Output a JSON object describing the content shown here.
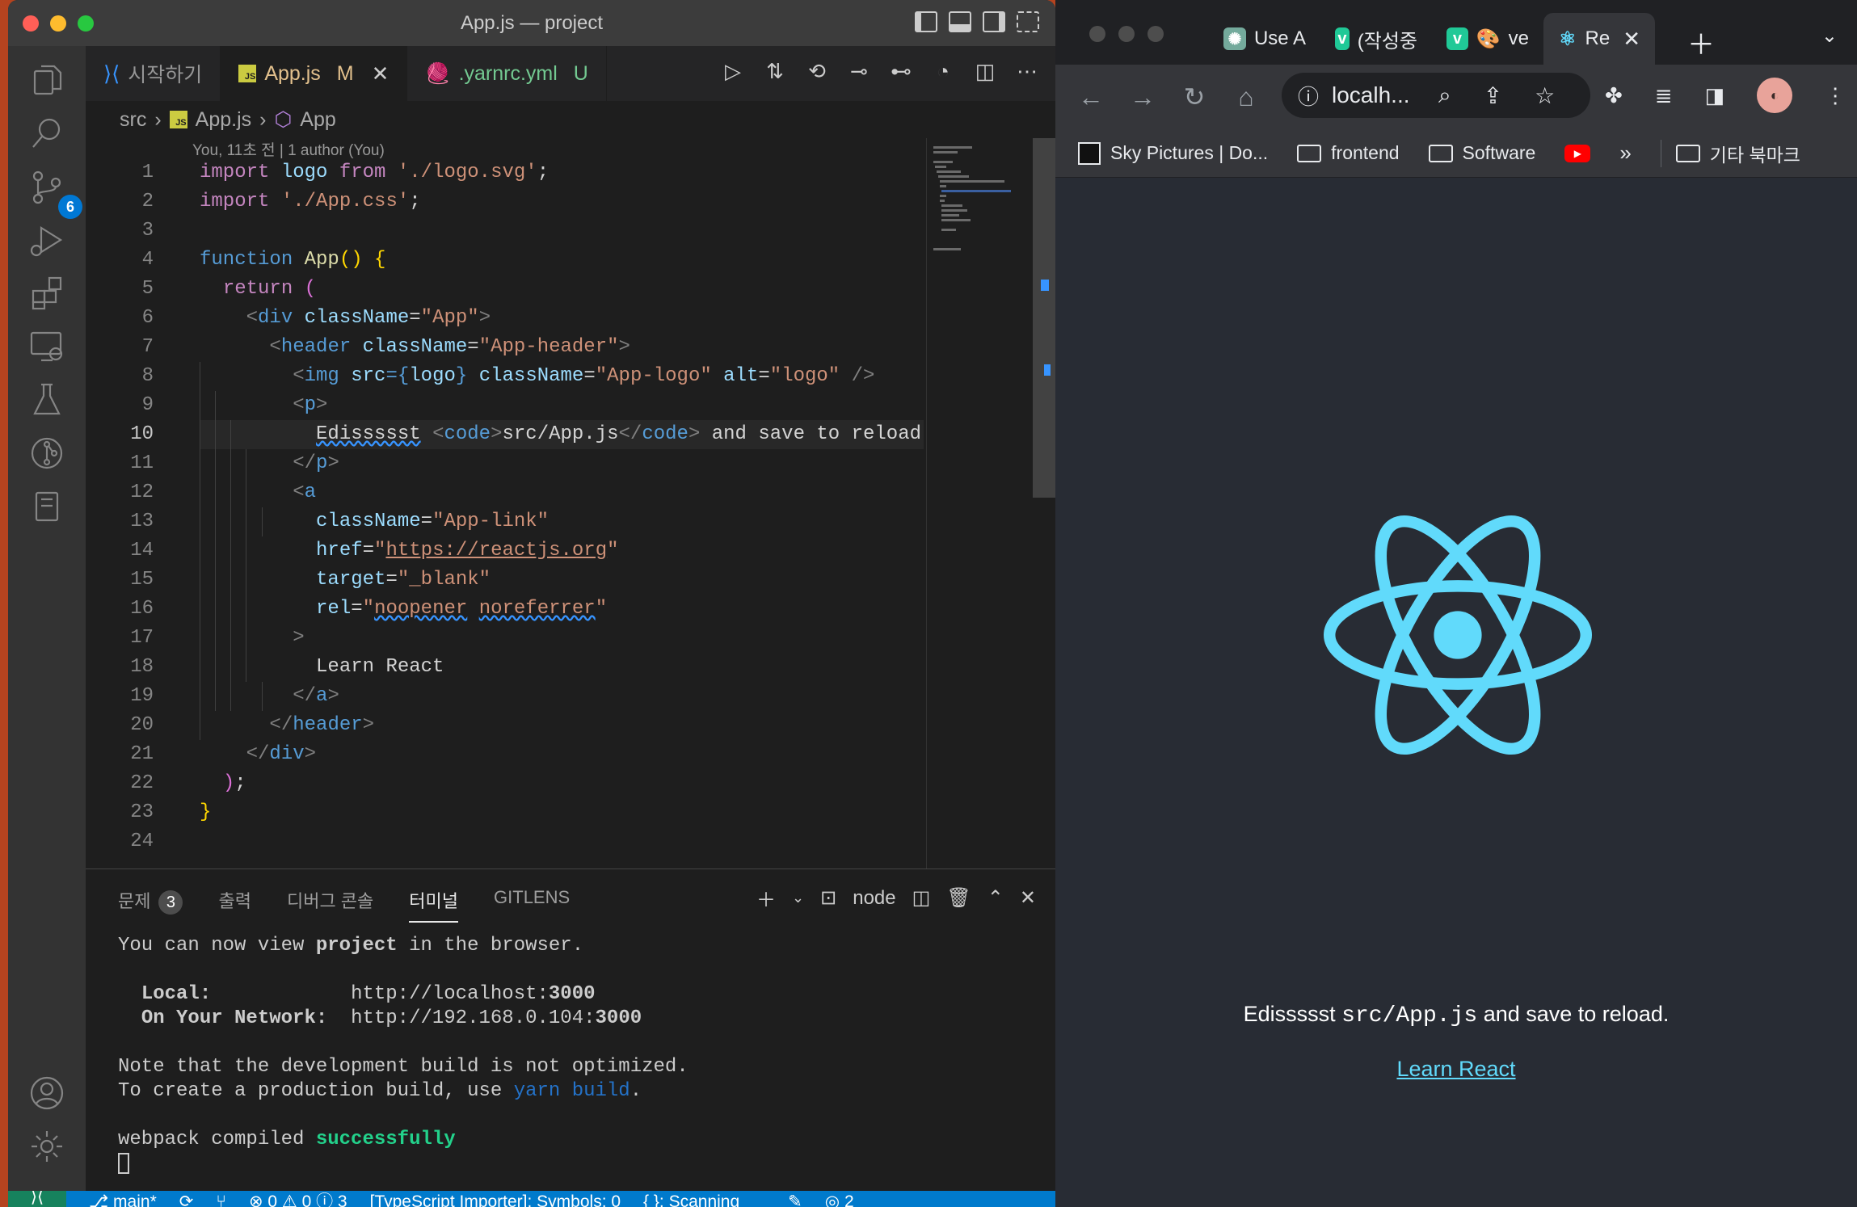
{
  "vscode": {
    "title": "App.js — project",
    "activity": {
      "scm_badge": "6"
    },
    "tabs": [
      {
        "label": "시작하기",
        "icon": "vscode-icon"
      },
      {
        "label": "App.js",
        "status": "M",
        "icon": "js-file-icon"
      },
      {
        "label": ".yarnrc.yml",
        "status": "U",
        "icon": "yarn-icon"
      }
    ],
    "breadcrumb": {
      "folder": "src",
      "file": "App.js",
      "symbol": "App"
    },
    "codelens": "You, 11초 전 | 1 author (You)",
    "line_numbers": [
      "1",
      "2",
      "3",
      "4",
      "5",
      "6",
      "7",
      "8",
      "9",
      "10",
      "11",
      "12",
      "13",
      "14",
      "15",
      "16",
      "17",
      "18",
      "19",
      "20",
      "21",
      "22",
      "23",
      "24"
    ],
    "current_line": "10",
    "code": {
      "l1": [
        "import",
        "logo",
        "from",
        "'./logo.svg'",
        ";"
      ],
      "l2": [
        "import",
        "'./App.css'",
        ";"
      ],
      "l4": [
        "function",
        "App",
        "() {"
      ],
      "l5": [
        "return",
        "("
      ],
      "l6": [
        "<",
        "div",
        "className",
        "=",
        "\"App\"",
        ">"
      ],
      "l7": [
        "<",
        "header",
        "className",
        "=",
        "\"App-header\"",
        ">"
      ],
      "l8": [
        "<",
        "img",
        "src",
        "={",
        "logo",
        "}",
        "className",
        "=",
        "\"App-logo\"",
        "alt",
        "=",
        "\"logo\"",
        "/>"
      ],
      "l9": [
        "<",
        "p",
        ">"
      ],
      "l10": [
        "Edissssst",
        "<",
        "code",
        ">",
        "src/App.js",
        "</",
        "code",
        ">",
        "and save to reload"
      ],
      "l11": [
        "</",
        "p",
        ">"
      ],
      "l12": [
        "<",
        "a"
      ],
      "l13": [
        "className",
        "=",
        "\"App-link\""
      ],
      "l14": [
        "href",
        "=",
        "\"",
        "https://reactjs.org",
        "\""
      ],
      "l15": [
        "target",
        "=",
        "\"_blank\""
      ],
      "l16": [
        "rel",
        "=",
        "\"",
        "noopener",
        "noreferrer",
        "\""
      ],
      "l17": [
        ">"
      ],
      "l18": [
        "Learn React"
      ],
      "l19": [
        "</",
        "a",
        ">"
      ],
      "l20": [
        "</",
        "header",
        ">"
      ],
      "l21": [
        "</",
        "div",
        ">"
      ],
      "l22": [
        ")",
        ";"
      ],
      "l23": [
        "}"
      ]
    },
    "panel": {
      "tabs": [
        {
          "label": "문제",
          "badge": "3"
        },
        {
          "label": "출력"
        },
        {
          "label": "디버그 콘솔"
        },
        {
          "label": "터미널",
          "active": true
        },
        {
          "label": "GITLENS"
        }
      ],
      "terminal_name": "node",
      "terminal": {
        "line1_pre": "You can now view ",
        "line1_bold": "project",
        "line1_post": " in the browser.",
        "local_label": "Local:",
        "local_url_pre": "http://localhost:",
        "local_port": "3000",
        "network_label": "On Your Network:",
        "network_url_pre": "http://192.168.0.104:",
        "network_port": "3000",
        "note1": "Note that the development build is not optimized.",
        "note2_pre": "To create a production build, use ",
        "note2_cmd": "yarn build",
        "note2_post": ".",
        "compiled_pre": "webpack compiled ",
        "compiled_word": "successfully"
      }
    },
    "statusbar": {
      "branch": "main*",
      "problems": "⊗ 0 ⚠ 0 ⓘ 3",
      "ts_importer": "[TypeScript Importer]: Symbols: 0",
      "scanning": "{ }: Scanning",
      "notifications": "2"
    },
    "colors": {
      "accent": "#007acc",
      "editor_bg": "#1e1e1e",
      "modified": "#e2c08d"
    }
  },
  "chrome": {
    "tabs": [
      {
        "label": "Use A",
        "icon": "chatgpt-icon"
      },
      {
        "label": "(작성중",
        "icon": "velog-icon"
      },
      {
        "label": "ve",
        "icon": "velog-icon"
      },
      {
        "label": "Re",
        "icon": "react-icon",
        "active": true
      }
    ],
    "omnibox": "localh...",
    "bookmarks": [
      {
        "label": "Sky Pictures | Do...",
        "icon": "unsplash-icon"
      },
      {
        "label": "frontend",
        "icon": "folder-icon"
      },
      {
        "label": "Software",
        "icon": "folder-icon"
      },
      {
        "label": "",
        "icon": "youtube-icon"
      },
      {
        "label": "»",
        "icon": "more-icon"
      },
      {
        "label": "기타 북마크",
        "icon": "folder-icon"
      }
    ],
    "page": {
      "edit_pre": "Edissssst ",
      "edit_code": "src/App.js",
      "edit_post": " and save to reload.",
      "link": "Learn React"
    },
    "colors": {
      "react": "#61dafb",
      "page_bg": "#282c34"
    }
  }
}
